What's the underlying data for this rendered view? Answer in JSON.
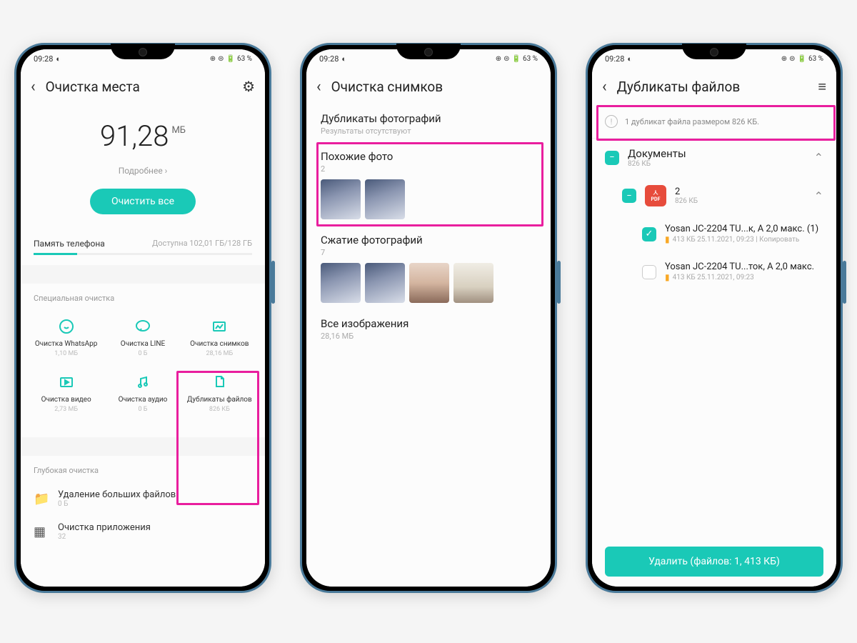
{
  "statusbar": {
    "time": "09:28",
    "battery": "63 %"
  },
  "screen1": {
    "title": "Очистка места",
    "storage_value": "91,28",
    "storage_unit": "МБ",
    "more": "Подробнее ›",
    "clean_all": "Очистить все",
    "memory_label": "Память телефона",
    "memory_avail": "Доступна 102,01 ГБ/128 ГБ",
    "special_title": "Специальная очистка",
    "special": [
      {
        "label": "Очистка WhatsApp",
        "size": "1,10 МБ"
      },
      {
        "label": "Очистка LINE",
        "size": "0 Б"
      },
      {
        "label": "Очистка снимков",
        "size": "28,16 МБ"
      },
      {
        "label": "Очистка видео",
        "size": "2,73 МБ"
      },
      {
        "label": "Очистка аудио",
        "size": "0 Б"
      },
      {
        "label": "Дубликаты файлов",
        "size": "826 КБ"
      }
    ],
    "deep_title": "Глубокая очистка",
    "deep": [
      {
        "label": "Удаление больших файлов",
        "sub": "0 Б"
      },
      {
        "label": "Очистка приложения",
        "sub": "32"
      }
    ]
  },
  "screen2": {
    "title": "Очистка снимков",
    "sections": [
      {
        "title": "Дубликаты фотографий",
        "sub": "Результаты отсутствуют"
      },
      {
        "title": "Похожие фото",
        "sub": "2"
      },
      {
        "title": "Сжатие фотографий",
        "sub": "7"
      },
      {
        "title": "Все изображения",
        "sub": "28,16 МБ"
      }
    ]
  },
  "screen3": {
    "title": "Дубликаты файлов",
    "info": "1 дубликат файла размером 826 КБ.",
    "group": {
      "title": "Документы",
      "sub": "826 КБ"
    },
    "subgroup": {
      "title": "2",
      "sub": "826 КБ"
    },
    "files": [
      {
        "name": "Yosan JC-2204 TU...к, А 2,0 макс. (1)",
        "meta": "413 КБ 25.11.2021, 09:23  |  Копировать",
        "checked": true
      },
      {
        "name": "Yosan JC-2204 TU...ток, А 2,0 макс.",
        "meta": "413 КБ 25.11.2021, 09:23",
        "checked": false
      }
    ],
    "delete_btn": "Удалить (файлов: 1, 413 КБ)"
  }
}
